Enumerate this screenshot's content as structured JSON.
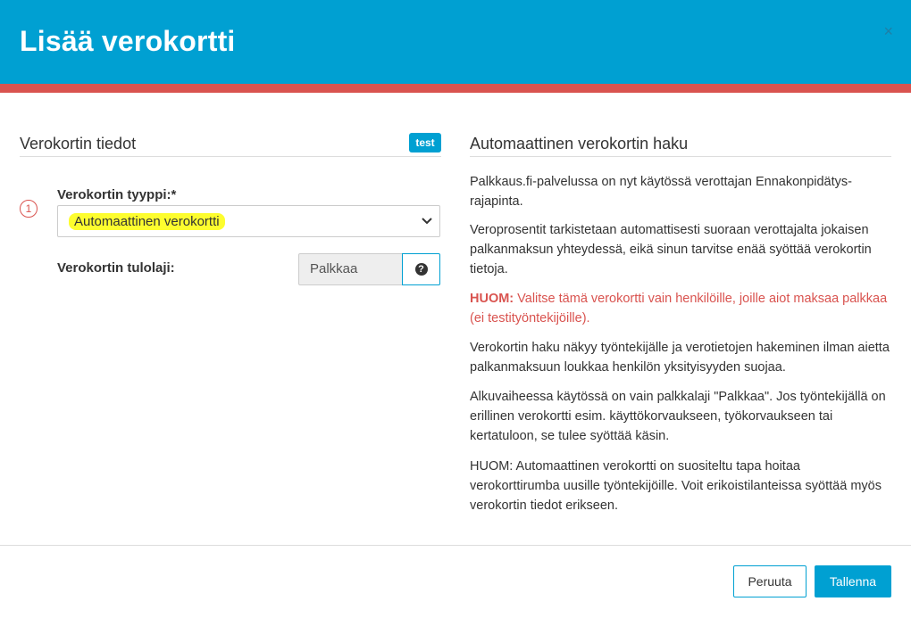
{
  "dialog": {
    "title": "Lisää verokortti",
    "close_icon": "×"
  },
  "left": {
    "section_title": "Verokortin tiedot",
    "badge": "test",
    "step_number": "1",
    "type_label": "Verokortin tyyppi:*",
    "type_value": "Automaattinen verokortti",
    "income_label": "Verokortin tulolaji:",
    "income_value": "Palkkaa",
    "help_icon": "?"
  },
  "right": {
    "section_title": "Automaattinen verokortin haku",
    "p1": "Palkkaus.fi-palvelussa on nyt käytössä verottajan Ennakonpidätys-rajapinta.",
    "p2": "Veroprosentit tarkistetaan automattisesti suoraan verottajalta jokaisen palkanmaksun yhteydessä, eikä sinun tarvitse enää syöttää verokortin tietoja.",
    "p3_strong": "HUOM:",
    "p3_text": " Valitse tämä verokortti vain henkilöille, joille aiot maksaa palkkaa (ei testityöntekijöille).",
    "p4": "Verokortin haku näkyy työntekijälle ja verotietojen hakeminen ilman aietta palkanmaksuun loukkaa henkilön yksityisyyden suojaa.",
    "p5": "Alkuvaiheessa käytössä on vain palkkalaji \"Palkkaa\". Jos työntekijällä on erillinen verokortti esim. käyttökorvaukseen, työkorvaukseen tai kertatuloon, se tulee syöttää käsin.",
    "p6": "HUOM: Automaattinen verokortti on suositeltu tapa hoitaa verokorttirumba uusille työntekijöille. Voit erikoistilanteissa syöttää myös verokortin tiedot erikseen."
  },
  "footer": {
    "cancel_label": "Peruuta",
    "save_label": "Tallenna"
  },
  "colors": {
    "header_blue": "#00a0d2",
    "stripe_red": "#d9534f",
    "highlight_yellow": "#fdfd2e"
  }
}
